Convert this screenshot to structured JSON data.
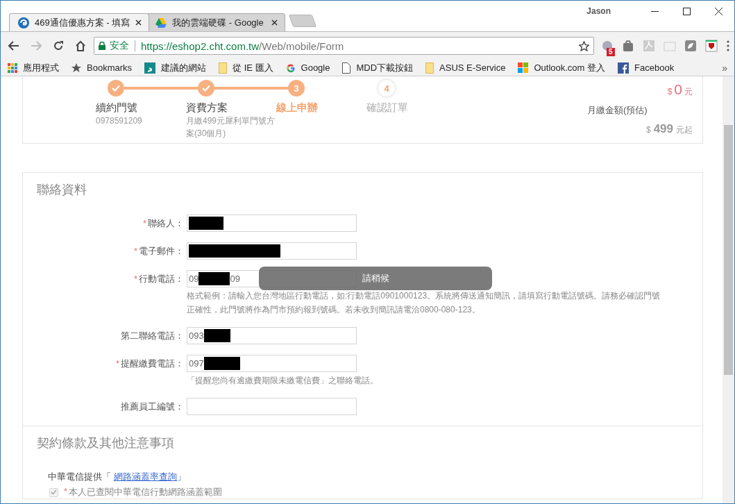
{
  "browser": {
    "profile": "Jason",
    "tabs": [
      {
        "title": "469通信優惠方案 - 填寫",
        "selected": true
      },
      {
        "title": "我的雲端硬碟 - Google",
        "selected": false
      }
    ],
    "security": "安全",
    "url_host": "https://eshop2.cht.com.tw",
    "url_path": "/Web/mobile/Form",
    "extension_badge": "5",
    "bookmarks": [
      {
        "label": "應用程式"
      },
      {
        "label": "Bookmarks"
      },
      {
        "label": "建議的網站"
      },
      {
        "label": "從 IE 匯入"
      },
      {
        "label": "Google"
      },
      {
        "label": "MDD下載按鈕"
      },
      {
        "label": "ASUS E-Service"
      },
      {
        "label": "Outlook.com 登入"
      },
      {
        "label": "Facebook"
      }
    ],
    "more": "»"
  },
  "steps": [
    {
      "title": "續約門號",
      "subtitle": "0978591209",
      "kind": "done"
    },
    {
      "title": "資費方案",
      "subtitle": "月繳499元犀利單門號方案(30個月)",
      "kind": "done"
    },
    {
      "number": "3",
      "title": "線上申辦",
      "kind": "current"
    },
    {
      "number": "4",
      "title": "確認訂單",
      "kind": "pending"
    }
  ],
  "summary": {
    "total_currency": "$",
    "total_amount": "0",
    "total_unit": "元",
    "monthly_label": "月繳金額(預估)",
    "monthly_currency": "$",
    "monthly_amount": "499",
    "monthly_unit": "元起"
  },
  "contact": {
    "title": "聯絡資料",
    "fields": [
      {
        "required_mark": "*",
        "label": "聯絡人：",
        "redacted": true
      },
      {
        "required_mark": "*",
        "label": "電子郵件：",
        "redacted": true
      },
      {
        "required_mark": "*",
        "label": "行動電話：",
        "value_start": "09",
        "redacted": true,
        "value_end": "09",
        "hint": "格式範例：請輸入您台灣地區行動電話，如:行動電話0901000123。系統將傳送通知簡訊，請填寫行動電話號碼。請務必確認門號正確性，此門號將作為門市預約報到號碼。若未收到簡訊請電洽0800-080-123。"
      },
      {
        "label": "第二聯絡電話：",
        "value_start": "093",
        "redacted": true
      },
      {
        "required_mark": "*",
        "label": "提醒繳費電話：",
        "value_start": "097",
        "redacted": true,
        "hint": "「提醒您尚有逾繳費期限未繳電信費」之聯絡電話。"
      },
      {
        "label": "推薦員工編號：",
        "redacted": false
      }
    ]
  },
  "terms": {
    "title": "契約條款及其他注意事項",
    "provider_text": "中華電信提供「",
    "link": "網路涵蓋率查詢",
    "provider_end": "」",
    "agree_required_mark": "*",
    "agree_label": "本人已查閱中華電信行動網路涵蓋範圍",
    "agree_checked": true,
    "agree_disabled": true
  },
  "toast": "請稍候"
}
